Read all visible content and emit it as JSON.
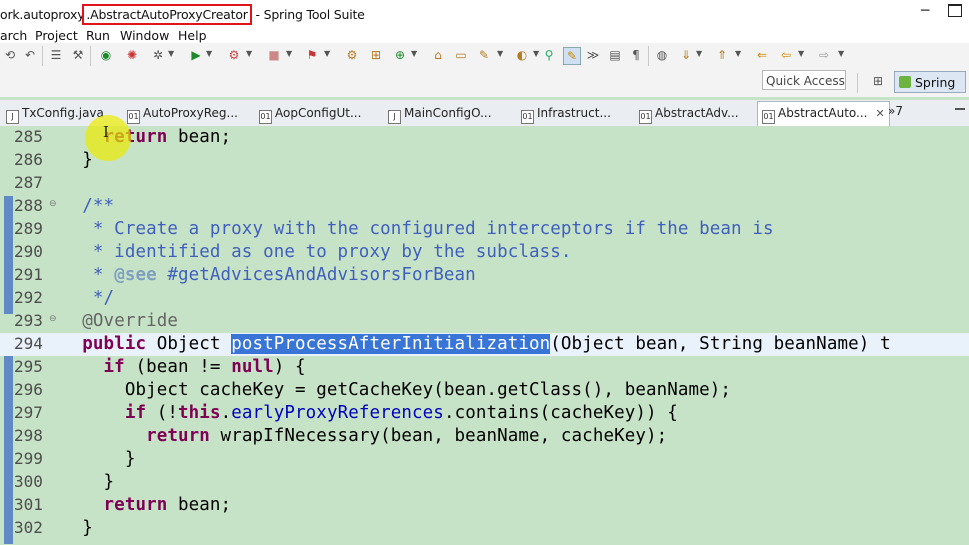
{
  "window": {
    "title_prefix": "ork.autoproxy",
    "title_highlight": ".AbstractAutoProxyCreator",
    "title_suffix": " - Spring Tool Suite",
    "minimize": "─"
  },
  "menu": {
    "items": [
      {
        "label": "arch"
      },
      {
        "label": "Project"
      },
      {
        "label": "Run"
      },
      {
        "label": "Window"
      },
      {
        "label": "Help"
      }
    ]
  },
  "toolbar": {
    "quick_access": "Quick Access",
    "perspective_label": "Spring"
  },
  "tabs": [
    {
      "label": "TxConfig.java",
      "icon": "J"
    },
    {
      "label": "AutoProxyReg...",
      "icon": "01"
    },
    {
      "label": "AopConfigUt...",
      "icon": "01"
    },
    {
      "label": "MainConfigO...",
      "icon": "J"
    },
    {
      "label": "Infrastruct...",
      "icon": "01"
    },
    {
      "label": "AbstractAdv...",
      "icon": "01"
    },
    {
      "label": "AbstractAuto...",
      "icon": "01",
      "active": true
    }
  ],
  "tab_overflow": "»7",
  "tab_close": "✕",
  "editor": {
    "line_numbers": [
      "285",
      "286",
      "287",
      "288",
      "289",
      "290",
      "291",
      "292",
      "293",
      "294",
      "295",
      "296",
      "297",
      "298",
      "299",
      "300",
      "301",
      "302"
    ],
    "current_line": "294",
    "selected_text": "postProcessAfterInitialization"
  }
}
